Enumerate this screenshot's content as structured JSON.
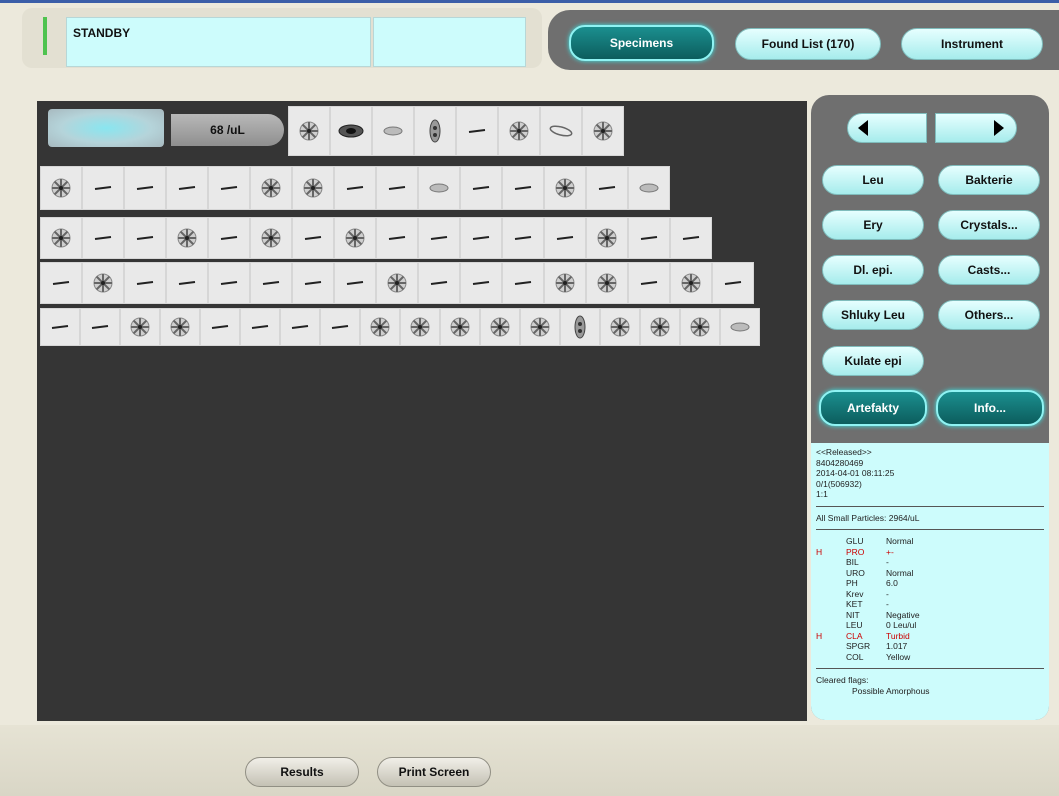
{
  "status": {
    "text": "STANDBY"
  },
  "nav": {
    "specimens": "Specimens",
    "found_list": "Found List (170)",
    "instrument": "Instrument"
  },
  "gallery": {
    "concentration": "68 /uL"
  },
  "categories": {
    "leu": "Leu",
    "bakterie": "Bakterie",
    "ery": "Ery",
    "crystals": "Crystals...",
    "dl_epi": "Dl. epi.",
    "casts": "Casts...",
    "shluky_leu": "Shluky Leu",
    "others": "Others...",
    "kulate_epi": "Kulate epi",
    "artefakty": "Artefakty",
    "info": "Info..."
  },
  "sample": {
    "release_status": "<<Released>>",
    "sample_id": "8404280469",
    "datetime": "2014-04-01 08:11:25",
    "rack": "0/1(506932)",
    "dilution": "1:1",
    "small_particles": "All Small Particles: 2964/uL",
    "chemistry": [
      {
        "flag": "",
        "name": "GLU",
        "value": "Normal"
      },
      {
        "flag": "H",
        "name": "PRO",
        "value": "+-"
      },
      {
        "flag": "",
        "name": "BIL",
        "value": "-"
      },
      {
        "flag": "",
        "name": "URO",
        "value": "Normal"
      },
      {
        "flag": "",
        "name": "PH",
        "value": "6.0"
      },
      {
        "flag": "",
        "name": "Krev",
        "value": "-"
      },
      {
        "flag": "",
        "name": "KET",
        "value": "-"
      },
      {
        "flag": "",
        "name": "NIT",
        "value": "Negative"
      },
      {
        "flag": "",
        "name": "LEU",
        "value": "0 Leu/ul"
      },
      {
        "flag": "H",
        "name": "CLA",
        "value": "Turbid"
      },
      {
        "flag": "",
        "name": "SPGR",
        "value": "1.017"
      },
      {
        "flag": "",
        "name": "COL",
        "value": "Yellow"
      }
    ],
    "cleared_flags_label": "Cleared flags:",
    "cleared_flags_value": "Possible Amorphous"
  },
  "bottom": {
    "results": "Results",
    "print_screen": "Print Screen"
  },
  "particle_rows": [
    [
      "star",
      "dark",
      "blob",
      "cluster",
      "streak",
      "star",
      "oval",
      "star"
    ],
    [
      "star",
      "streak",
      "streak",
      "streak",
      "streak",
      "star",
      "star",
      "streak",
      "streak",
      "blob",
      "streak",
      "streak",
      "star",
      "streak",
      "blob"
    ],
    [
      "star",
      "streak",
      "streak",
      "star",
      "streak",
      "star",
      "streak",
      "star",
      "streak",
      "streak",
      "streak",
      "streak",
      "streak",
      "star",
      "streak",
      "streak"
    ],
    [
      "streak",
      "star",
      "streak",
      "streak",
      "streak",
      "streak",
      "streak",
      "streak",
      "star",
      "streak",
      "streak",
      "streak",
      "star",
      "star",
      "streak",
      "star",
      "streak"
    ],
    [
      "streak",
      "streak",
      "star",
      "star",
      "streak",
      "streak",
      "streak",
      "streak",
      "star",
      "star",
      "star",
      "star",
      "star",
      "cluster",
      "star",
      "star",
      "star",
      "blob"
    ]
  ]
}
